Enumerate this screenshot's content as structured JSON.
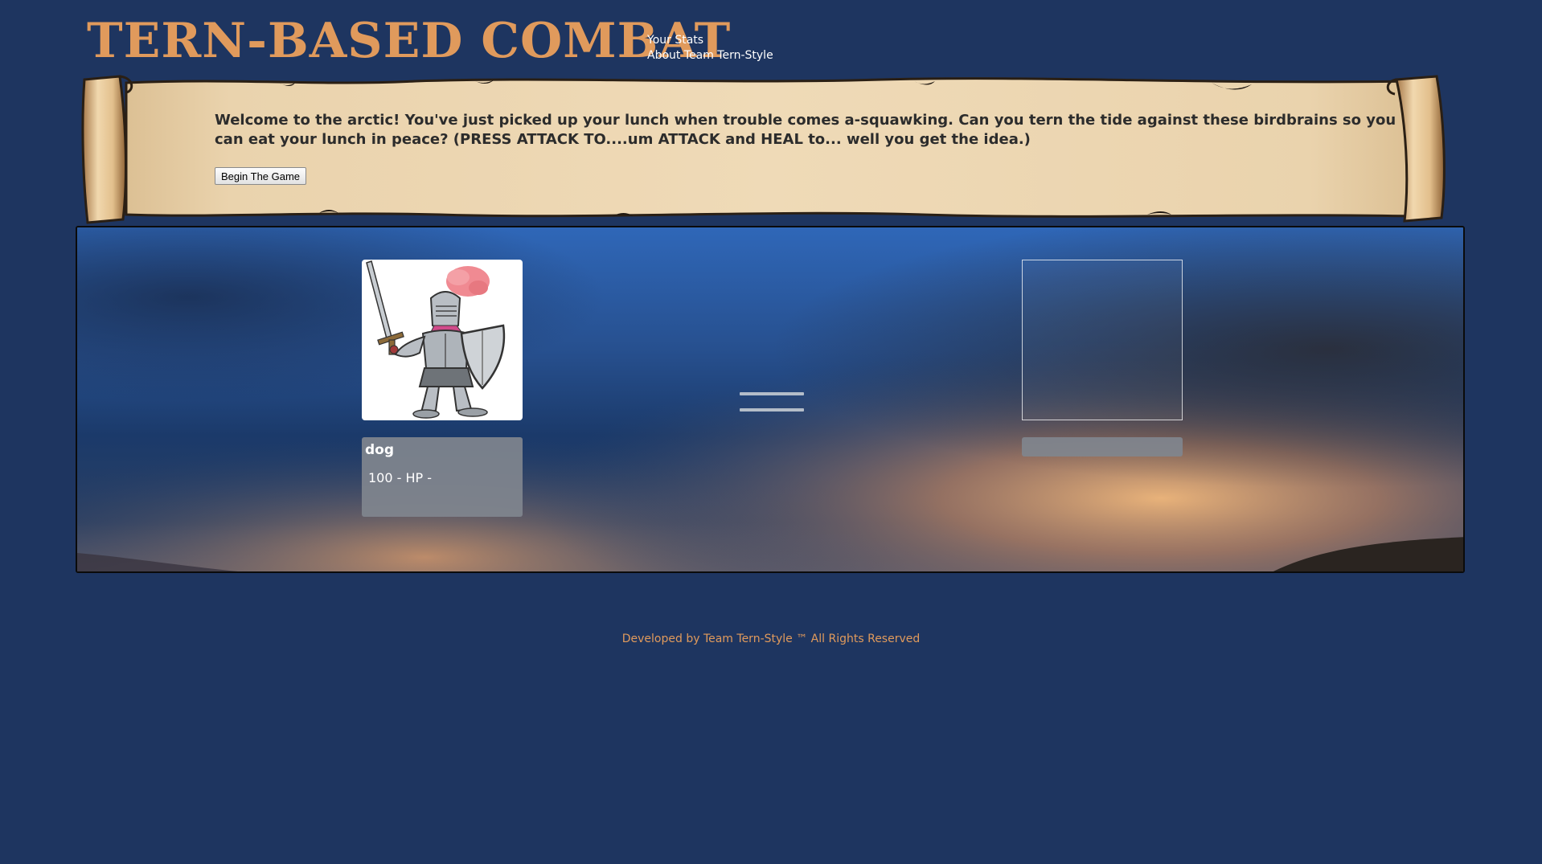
{
  "header": {
    "title": "TERN-BASED COMBAT",
    "nav": [
      {
        "label": "Your Stats"
      },
      {
        "label": "About Team Tern-Style"
      }
    ]
  },
  "intro": {
    "text": "Welcome to the arctic! You've just picked up your lunch when trouble comes a-squawking. Can you tern the tide against these birdbrains so you can eat your lunch in peace? (PRESS ATTACK TO....um ATTACK and HEAL to... well you get the idea.)",
    "begin_button": "Begin The Game"
  },
  "player": {
    "name": "dog",
    "hp_text": "100 - HP -"
  },
  "footer": {
    "text": "Developed by Team Tern-Style ™ All Rights Reserved"
  },
  "colors": {
    "background": "#1e3560",
    "title": "#e09a5c",
    "parchment": "#e7cda2",
    "info_panel": "#80868e"
  }
}
